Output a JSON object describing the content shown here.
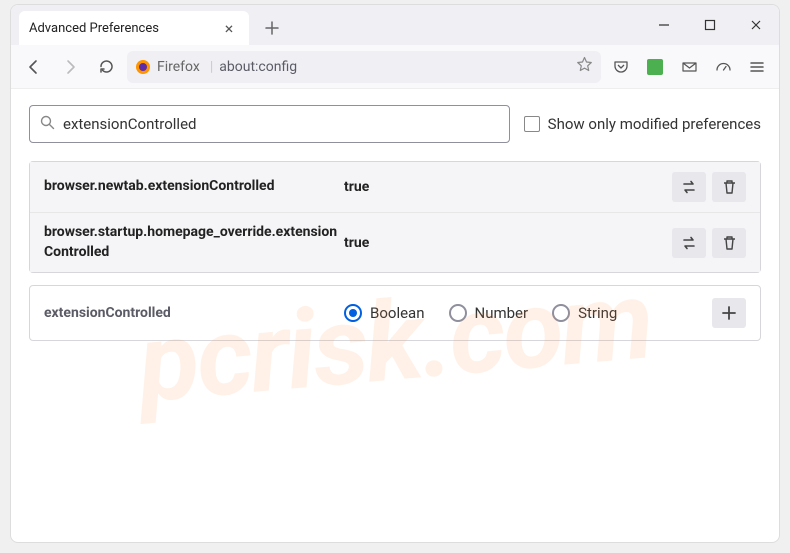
{
  "tab": {
    "title": "Advanced Preferences"
  },
  "urlbar": {
    "brand": "Firefox",
    "path": "about:config"
  },
  "search": {
    "value": "extensionControlled",
    "checkbox_label": "Show only modified preferences"
  },
  "prefs": [
    {
      "name": "browser.newtab.extensionControlled",
      "value": "true"
    },
    {
      "name": "browser.startup.homepage_override.extensionControlled",
      "value": "true"
    }
  ],
  "new_pref": {
    "name": "extensionControlled",
    "types": [
      "Boolean",
      "Number",
      "String"
    ],
    "selected": 0
  },
  "watermark": "pcrisk.com"
}
